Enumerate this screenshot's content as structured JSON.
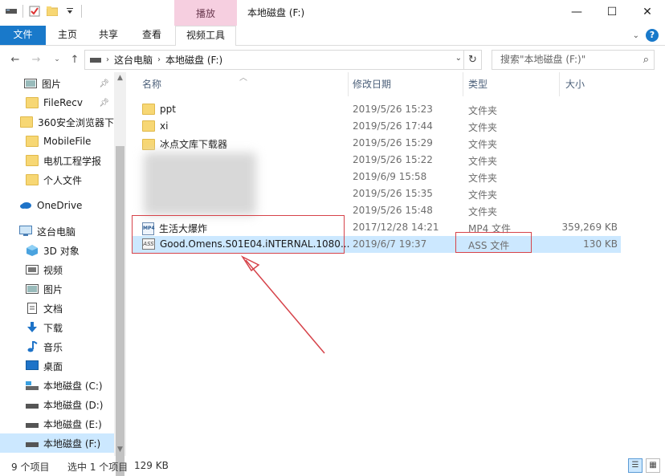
{
  "window": {
    "title": "本地磁盘 (F:)",
    "context_tab": "播放",
    "buttons": {
      "minimize": "—",
      "maximize": "☐",
      "close": "✕"
    }
  },
  "ribbon": {
    "tabs": [
      "文件",
      "主页",
      "共享",
      "查看",
      "视频工具"
    ],
    "help": "?"
  },
  "address": {
    "segments": [
      "这台电脑",
      "本地磁盘 (F:)"
    ],
    "search_placeholder": "搜索\"本地磁盘 (F:)\""
  },
  "navpane": {
    "items": [
      {
        "label": "图片",
        "icon": "pictures-icon",
        "pinned": true
      },
      {
        "label": "FileRecv",
        "icon": "folder-icon",
        "pinned": true
      },
      {
        "label": "360安全浏览器下",
        "icon": "folder-icon"
      },
      {
        "label": "MobileFile",
        "icon": "folder-icon"
      },
      {
        "label": "电机工程学报",
        "icon": "folder-icon"
      },
      {
        "label": "个人文件",
        "icon": "folder-icon"
      },
      {
        "label": "OneDrive",
        "icon": "cloud-icon"
      },
      {
        "label": "这台电脑",
        "icon": "computer-icon"
      },
      {
        "label": "3D 对象",
        "icon": "3d-objects-icon"
      },
      {
        "label": "视频",
        "icon": "videos-icon"
      },
      {
        "label": "图片",
        "icon": "pictures-icon"
      },
      {
        "label": "文档",
        "icon": "documents-icon"
      },
      {
        "label": "下载",
        "icon": "download-icon"
      },
      {
        "label": "音乐",
        "icon": "music-icon"
      },
      {
        "label": "桌面",
        "icon": "desktop-icon"
      },
      {
        "label": "本地磁盘 (C:)",
        "icon": "drive-icon"
      },
      {
        "label": "本地磁盘 (D:)",
        "icon": "drive-icon"
      },
      {
        "label": "本地磁盘 (E:)",
        "icon": "drive-icon"
      },
      {
        "label": "本地磁盘 (F:)",
        "icon": "drive-icon",
        "selected": true
      }
    ]
  },
  "columns": {
    "name": "名称",
    "date": "修改日期",
    "type": "类型",
    "size": "大小"
  },
  "files": [
    {
      "name": "ppt",
      "date": "2019/5/26 15:23",
      "type": "文件夹",
      "size": "",
      "icon": "folder-icon"
    },
    {
      "name": "xi",
      "date": "2019/5/26 17:44",
      "type": "文件夹",
      "size": "",
      "icon": "folder-icon"
    },
    {
      "name": "冰点文库下载器",
      "date": "2019/5/26 15:29",
      "type": "文件夹",
      "size": "",
      "icon": "folder-icon"
    },
    {
      "name": "",
      "date": "2019/5/26 15:22",
      "type": "文件夹",
      "size": "",
      "icon": "blurred"
    },
    {
      "name": "",
      "date": "2019/6/9 15:58",
      "type": "文件夹",
      "size": "",
      "icon": "blurred"
    },
    {
      "name": "",
      "date": "2019/5/26 15:35",
      "type": "文件夹",
      "size": "",
      "icon": "blurred"
    },
    {
      "name": "",
      "date": "2019/5/26 15:48",
      "type": "文件夹",
      "size": "",
      "icon": "blurred"
    },
    {
      "name": "生活大爆炸",
      "date": "2017/12/28 14:21",
      "type": "MP4 文件",
      "size": "359,269 KB",
      "icon": "mp4-file-icon"
    },
    {
      "name": "Good.Omens.S01E04.iNTERNAL.1080...",
      "date": "2019/6/7 19:37",
      "type": "ASS 文件",
      "size": "130 KB",
      "icon": "ass-file-icon",
      "selected": true
    }
  ],
  "status": {
    "count": "9 个项目",
    "selected": "选中 1 个项目",
    "size": "129 KB"
  },
  "colors": {
    "accent": "#1979ca",
    "selection": "#cce8ff",
    "annotation": "#d6434a"
  }
}
